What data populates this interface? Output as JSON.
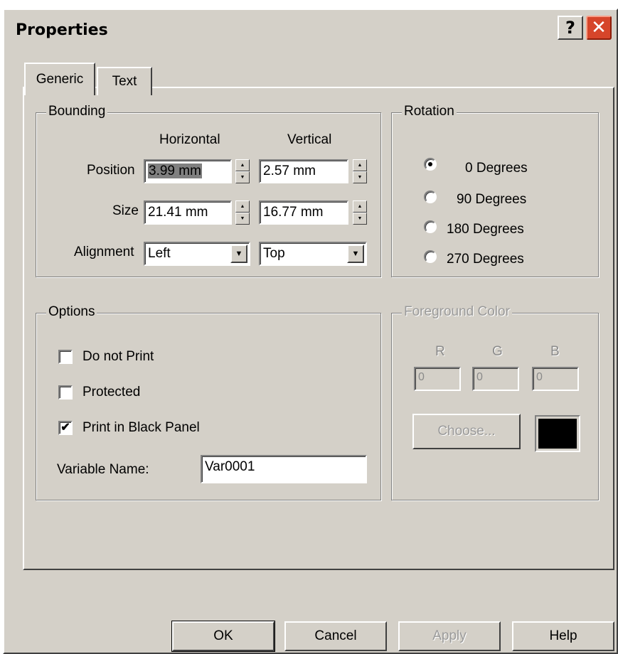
{
  "window": {
    "title": "Properties",
    "help_glyph": "?",
    "close_glyph": "✕"
  },
  "tabs": [
    {
      "label": "Generic"
    },
    {
      "label": "Text"
    }
  ],
  "bounding": {
    "title": "Bounding",
    "col_horizontal": "Horizontal",
    "col_vertical": "Vertical",
    "position_label": "Position",
    "position_h": "3.99 mm",
    "position_v": "2.57 mm",
    "size_label": "Size",
    "size_h": "21.41 mm",
    "size_v": "16.77 mm",
    "alignment_label": "Alignment",
    "alignment_h": "Left",
    "alignment_v": "Top"
  },
  "rotation": {
    "title": "Rotation",
    "options": [
      "0 Degrees",
      "90 Degrees",
      "180 Degrees",
      "270 Degrees"
    ],
    "selected": "0 Degrees"
  },
  "options": {
    "title": "Options",
    "do_not_print": "Do not Print",
    "protected": "Protected",
    "print_black": "Print in Black Panel",
    "print_black_checked": true,
    "variable_label": "Variable Name:",
    "variable_value": "Var0001"
  },
  "foreground": {
    "title": "Foreground Color",
    "r_label": "R",
    "g_label": "G",
    "b_label": "B",
    "r": "0",
    "g": "0",
    "b": "0",
    "choose_label": "Choose...",
    "color": "#000000"
  },
  "buttons": {
    "ok": "OK",
    "cancel": "Cancel",
    "apply": "Apply",
    "help": "Help"
  },
  "glyphs": {
    "check": "✔",
    "dropdown": "▼",
    "spin_up": "▲",
    "spin_down": "▼"
  }
}
